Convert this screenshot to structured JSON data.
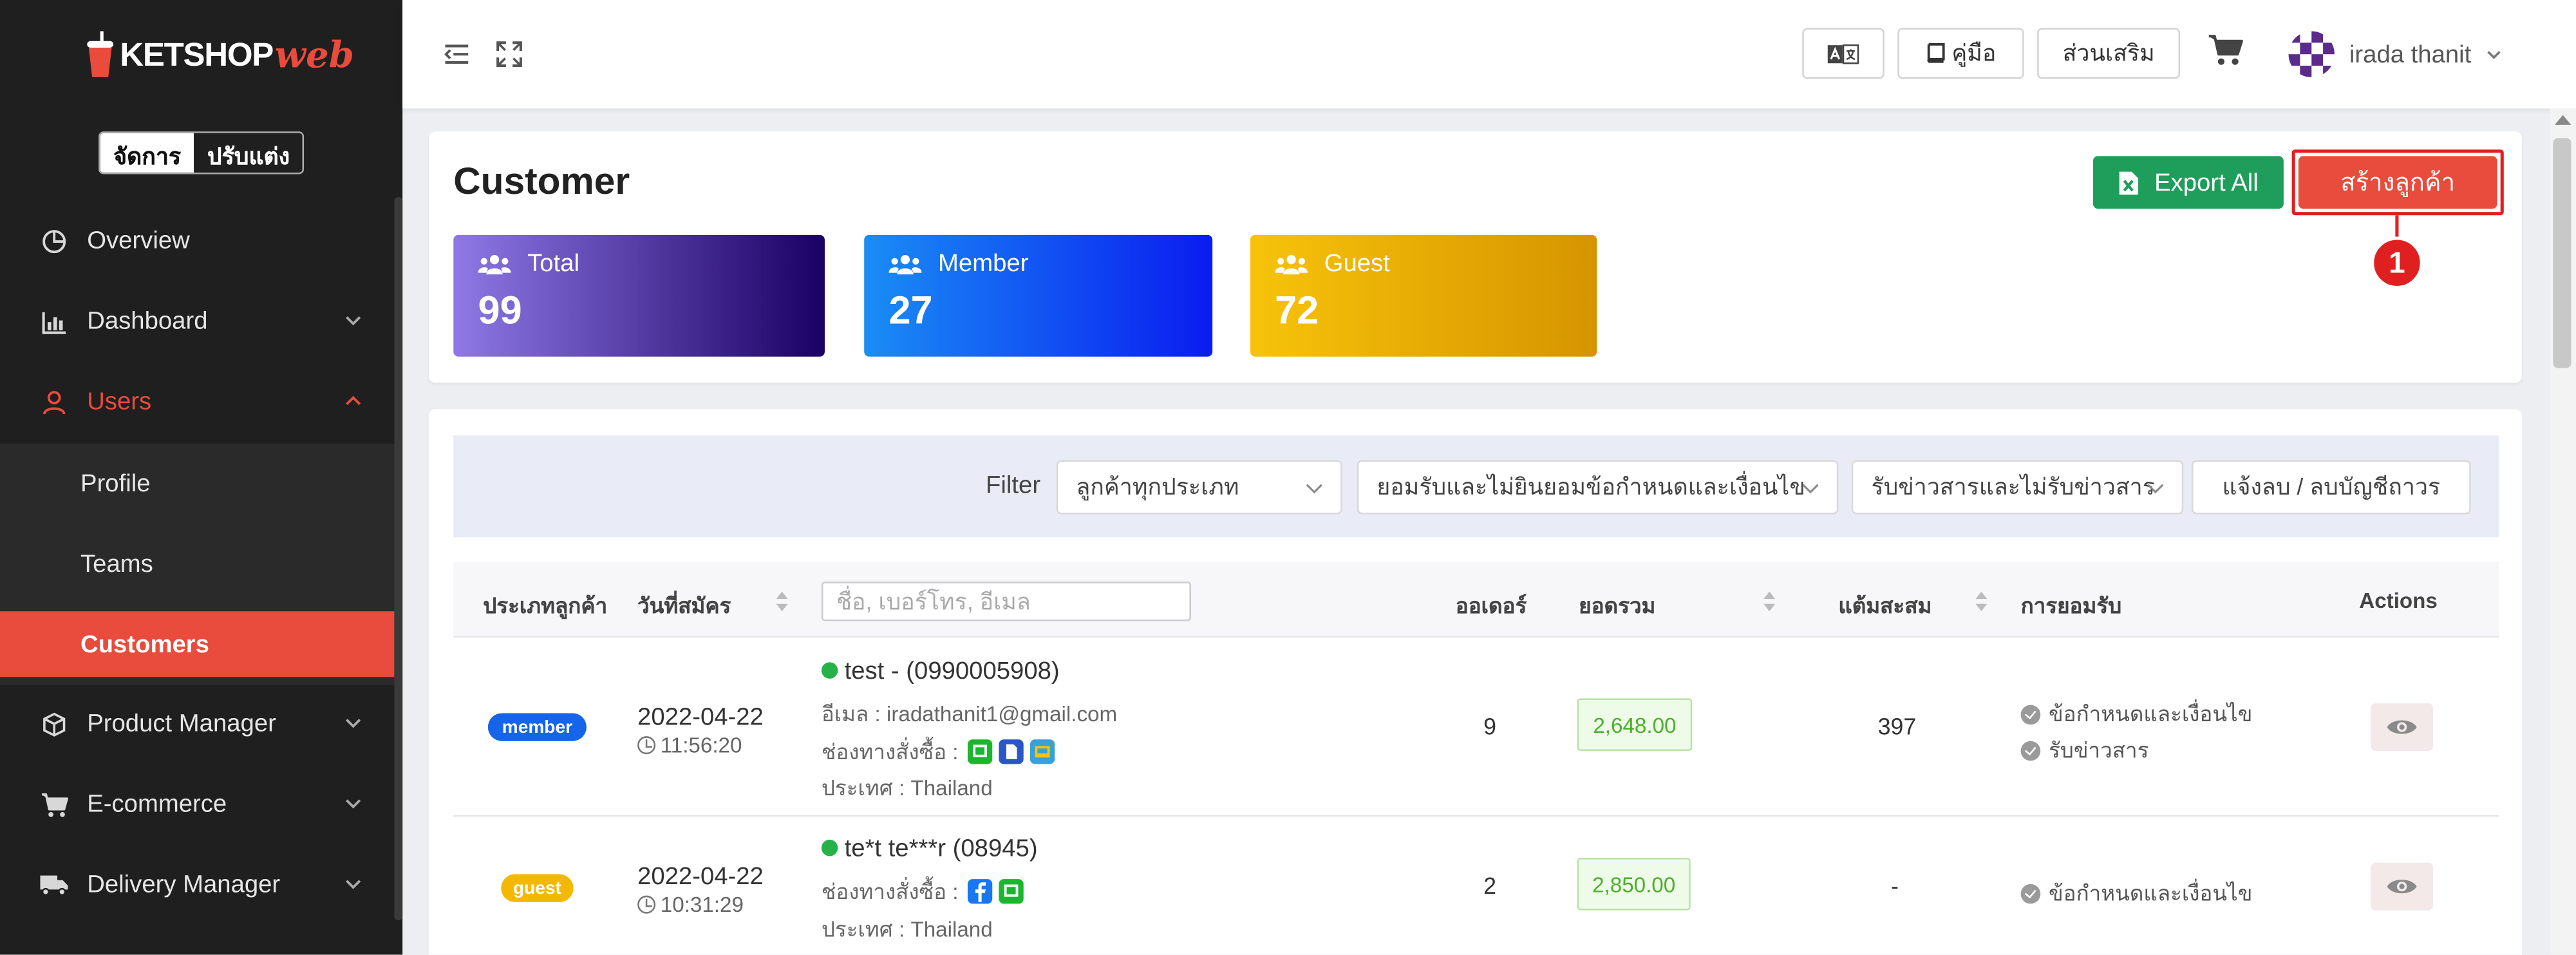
{
  "brand": {
    "logo_main": "KETSHOP",
    "logo_accent": "web"
  },
  "mode_toggle": {
    "manage": "จัดการ",
    "customize": "ปรับแต่ง"
  },
  "sidebar": {
    "items": [
      {
        "label": "Overview"
      },
      {
        "label": "Dashboard"
      },
      {
        "label": "Users"
      },
      {
        "label": "Product Manager"
      },
      {
        "label": "E-commerce"
      },
      {
        "label": "Delivery Manager"
      }
    ],
    "users_sub": [
      {
        "label": "Profile"
      },
      {
        "label": "Teams"
      },
      {
        "label": "Customers"
      }
    ]
  },
  "topbar": {
    "manual_label": "คู่มือ",
    "addons_label": "ส่วนเสริม",
    "user_name": "irada thanit"
  },
  "page": {
    "title": "Customer",
    "export_label": "Export All",
    "create_label": "สร้างลูกค้า",
    "callout_number": "1"
  },
  "stats": [
    {
      "label": "Total",
      "value": "99",
      "color_from": "#8f79e6",
      "color_to": "#1a0063"
    },
    {
      "label": "Member",
      "value": "27",
      "color_from": "#1a8df5",
      "color_to": "#0a1cf0"
    },
    {
      "label": "Guest",
      "value": "72",
      "color_from": "#f7c30a",
      "color_to": "#d69400"
    }
  ],
  "filter": {
    "label": "Filter",
    "customer_type": "ลูกค้าทุกประเภท",
    "terms": "ยอมรับและไม่ยินยอมข้อกำหนดและเงื่อนไข",
    "news": "รับข่าวสารและไม่รับข่าวสาร",
    "delete_btn": "แจ้งลบ / ลบบัญชีถาวร"
  },
  "table": {
    "headers": {
      "type": "ประเภทลูกค้า",
      "date": "วันที่สมัคร",
      "orders": "ออเดอร์",
      "total": "ยอดรวม",
      "points": "แต้มสะสม",
      "consent": "การยอมรับ",
      "actions": "Actions"
    },
    "search_placeholder": "ชื่อ, เบอร์โทร, อีเมล",
    "rows": [
      {
        "badge": "member",
        "date": "2022-04-22",
        "time": "11:56:20",
        "name": "test - (0990005908)",
        "email": "อีเมล : iradathanit1@gmail.com",
        "channels_label": "ช่องทางสั่งซื้อ :",
        "country": "ประเทศ : Thailand",
        "orders": "9",
        "total": "2,648.00",
        "points": "397",
        "consent": [
          "ข้อกำหนดและเงื่อนไข",
          "รับข่าวสาร"
        ]
      },
      {
        "badge": "guest",
        "date": "2022-04-22",
        "time": "10:31:29",
        "name": "te*t te***r (08945)",
        "channels_label": "ช่องทางสั่งซื้อ :",
        "country": "ประเทศ : Thailand",
        "orders": "2",
        "total": "2,850.00",
        "points": "-",
        "consent": [
          "ข้อกำหนดและเงื่อนไข"
        ]
      }
    ]
  },
  "colors": {
    "accent": "#e94b3c",
    "export_green": "#1e9e5a",
    "member_badge": "#1665e8",
    "guest_badge": "#f5b800"
  }
}
